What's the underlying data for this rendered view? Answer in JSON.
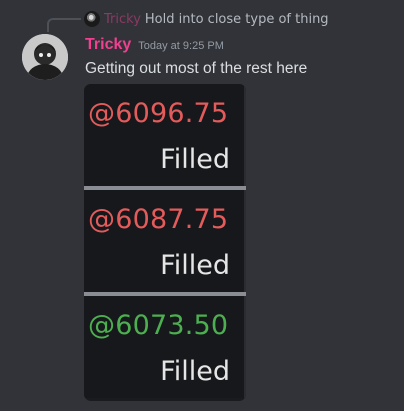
{
  "reply": {
    "author": "Tricky",
    "text": "Hold into close type of thing"
  },
  "message": {
    "author": "Tricky",
    "timestamp": "Today at 9:25 PM",
    "content": "Getting out most of the rest here"
  },
  "fills": [
    {
      "price": "@6096.75",
      "status": "Filled",
      "price_color": "#e35b5b"
    },
    {
      "price": "@6087.75",
      "status": "Filled",
      "price_color": "#e35b5b"
    },
    {
      "price": "@6073.50",
      "status": "Filled",
      "price_color": "#4caf50"
    }
  ],
  "colors": {
    "background": "#313338",
    "username": "#f23f8f",
    "reply_username": "#8a3a63",
    "text": "#dbdee1",
    "timestamp": "#949ba4"
  }
}
